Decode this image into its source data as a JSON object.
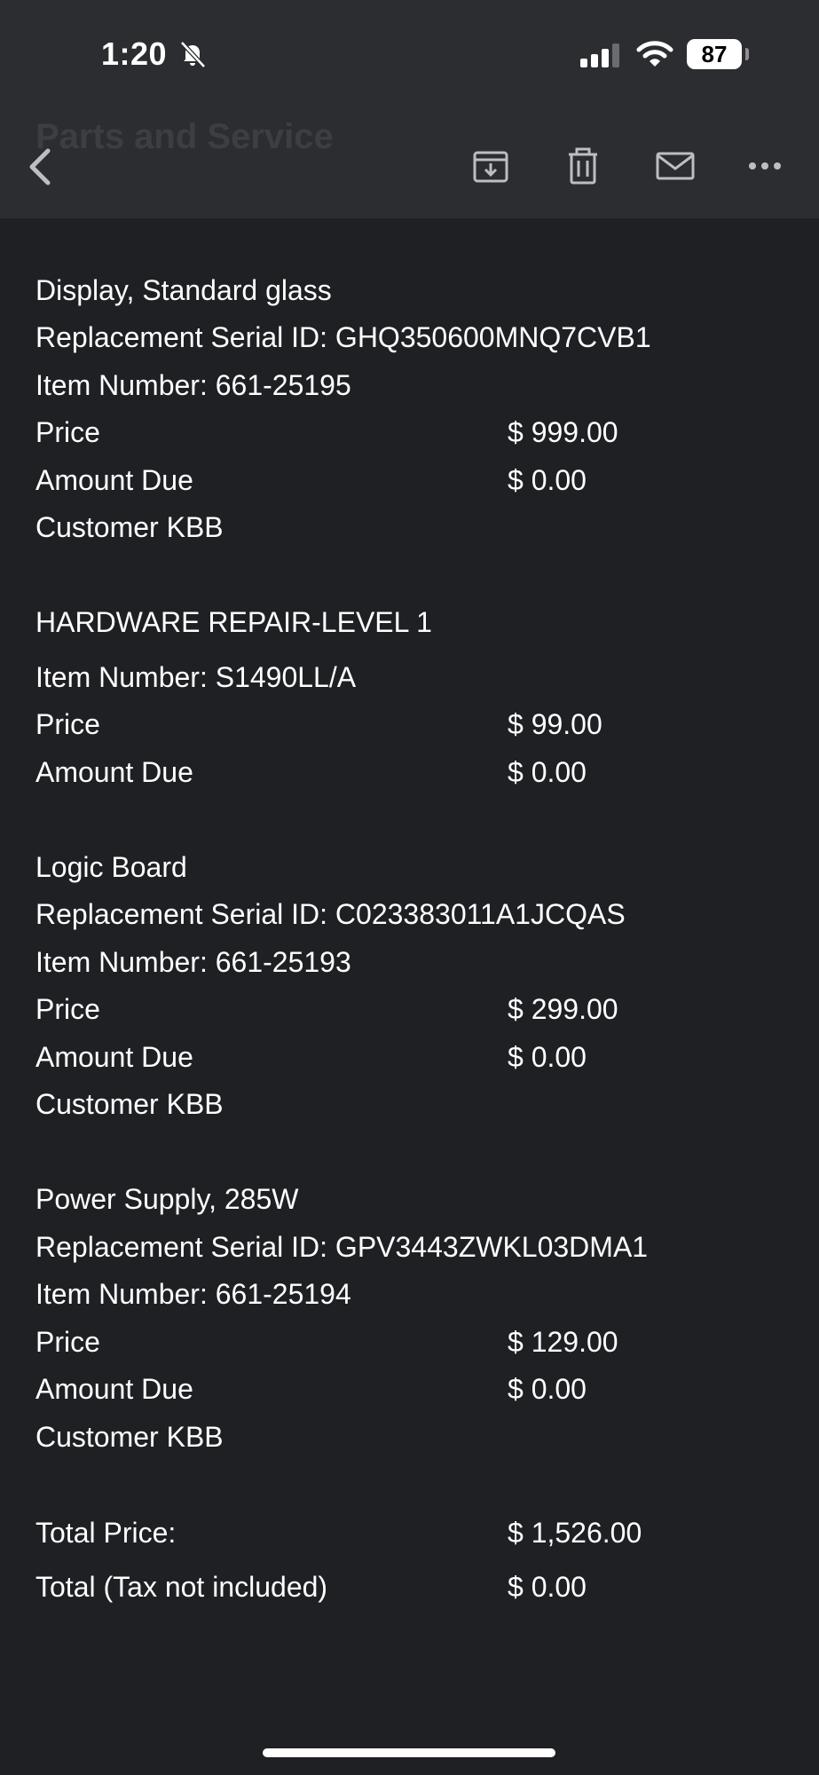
{
  "status_bar": {
    "time": "1:20",
    "battery": "87"
  },
  "header": {
    "title": "Parts and Service"
  },
  "items": [
    {
      "name": "Display, Standard glass",
      "serial": "Replacement Serial ID: GHQ350600MNQ7CVB1",
      "item_number": "Item Number: 661-25195",
      "price_label": "Price",
      "price": "$ 999.00",
      "due_label": "Amount Due",
      "due": "$ 0.00",
      "note": "Customer KBB"
    },
    {
      "name": "HARDWARE REPAIR-LEVEL 1",
      "item_number": "Item Number: S1490LL/A",
      "price_label": "Price",
      "price": "$ 99.00",
      "due_label": "Amount Due",
      "due": "$ 0.00"
    },
    {
      "name": "Logic Board",
      "serial": "Replacement Serial ID: C023383011A1JCQAS",
      "item_number": "Item Number: 661-25193",
      "price_label": "Price",
      "price": "$ 299.00",
      "due_label": "Amount Due",
      "due": "$ 0.00",
      "note": "Customer KBB"
    },
    {
      "name": "Power Supply, 285W",
      "serial": "Replacement Serial ID: GPV3443ZWKL03DMA1",
      "item_number": "Item Number: 661-25194",
      "price_label": "Price",
      "price": "$ 129.00",
      "due_label": "Amount Due",
      "due": "$ 0.00",
      "note": "Customer KBB"
    }
  ],
  "totals": {
    "total_label": "Total Price:",
    "total": "$ 1,526.00",
    "tax_label": "Total (Tax not included)",
    "tax": "$ 0.00"
  },
  "icons": [
    "bell-slash-icon",
    "signal-icon",
    "wifi-icon",
    "back-icon",
    "archive-icon",
    "trash-icon",
    "mail-icon",
    "more-icon"
  ]
}
